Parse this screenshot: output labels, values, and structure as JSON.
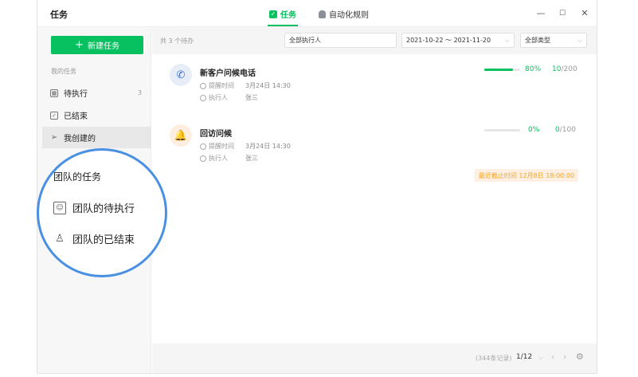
{
  "window": {
    "title": "任务"
  },
  "tabs": [
    {
      "label": "任务",
      "active": true
    },
    {
      "label": "自动化规则",
      "active": false
    }
  ],
  "window_controls": {
    "minimize": "—",
    "maximize": "☐",
    "close": "✕"
  },
  "sidebar": {
    "new_button": "新建任务",
    "my_tasks_label": "我的任务",
    "items": [
      {
        "label": "待执行",
        "count": "3",
        "icon": "calendar-icon"
      },
      {
        "label": "已结束",
        "count": "",
        "icon": "checkbox-icon"
      },
      {
        "label": "我创建的",
        "count": "",
        "icon": "send-icon"
      }
    ]
  },
  "filters": {
    "summary": "共 3 个待办",
    "assignee": "全部执行人",
    "date_range": "2021-10-22 ～ 2021-11-20",
    "type": "全部类型"
  },
  "tasks": [
    {
      "title": "新客户问候电话",
      "icon": "phone-icon",
      "remind_label": "提醒时间",
      "remind_value": "3月24日 14:30",
      "assignee_label": "执行人",
      "assignee_value": "张三",
      "progress": 0.8,
      "percent": "80%",
      "done": "10",
      "total": "/200"
    },
    {
      "title": "回访问候",
      "icon": "bell-icon",
      "remind_label": "提醒时间",
      "remind_value": "3月24日 14:30",
      "assignee_label": "执行人",
      "assignee_value": "张三",
      "progress": 0,
      "percent": "0%",
      "done": "0",
      "total": "/100",
      "deadline": "最近截止时间 12月8日 18:00:00"
    }
  ],
  "footer": {
    "records": "(344条记录)",
    "page": "1/12"
  },
  "lens": {
    "heading": "团队的任务",
    "items": [
      {
        "label": "团队的待执行",
        "icon": "team-pending-icon"
      },
      {
        "label": "团队的已结束",
        "icon": "team-done-icon"
      }
    ]
  },
  "colors": {
    "accent": "#07c160",
    "warning": "#f5a623",
    "highlight_ring": "#4a90e2"
  }
}
